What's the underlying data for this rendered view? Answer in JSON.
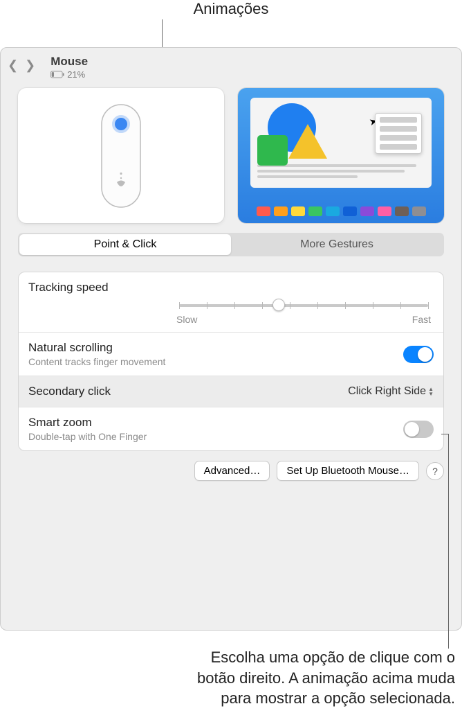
{
  "callouts": {
    "top": "Animações",
    "bottom_l1": "Escolha uma opção de clique com o",
    "bottom_l2": "botão direito. A animação acima muda",
    "bottom_l3": "para mostrar a opção selecionada."
  },
  "header": {
    "title": "Mouse",
    "battery": "21%"
  },
  "tabs": {
    "point_click": "Point & Click",
    "more_gestures": "More Gestures"
  },
  "settings": {
    "tracking": {
      "title": "Tracking speed",
      "slow": "Slow",
      "fast": "Fast"
    },
    "scrolling": {
      "title": "Natural scrolling",
      "sub": "Content tracks finger movement"
    },
    "secondary": {
      "title": "Secondary click",
      "value": "Click Right Side"
    },
    "smartzoom": {
      "title": "Smart zoom",
      "sub": "Double-tap with One Finger"
    }
  },
  "buttons": {
    "advanced": "Advanced…",
    "setup_bt": "Set Up Bluetooth Mouse…",
    "help": "?"
  },
  "palette_colors": [
    "#ff5a4d",
    "#ff9f1c",
    "#ffd93b",
    "#3ac561",
    "#1aa9e0",
    "#1060d6",
    "#8a4bd9",
    "#ff5fa5",
    "#6e5f57",
    "#8e8e93"
  ]
}
